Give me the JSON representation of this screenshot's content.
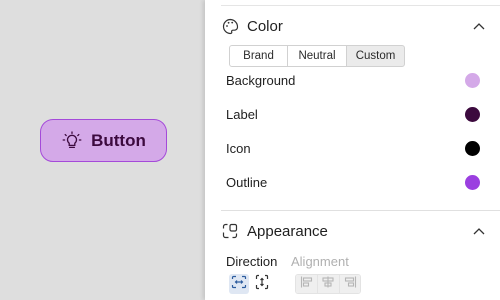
{
  "canvas": {
    "preview_button": {
      "label": "Button",
      "icon": "lightbulb-icon"
    }
  },
  "panel": {
    "color_section": {
      "title": "Color",
      "icon": "palette-icon",
      "tabs": [
        {
          "label": "Brand",
          "selected": false
        },
        {
          "label": "Neutral",
          "selected": false
        },
        {
          "label": "Custom",
          "selected": true
        }
      ],
      "rows": [
        {
          "label": "Background",
          "color": "#d4a9e8"
        },
        {
          "label": "Label",
          "color": "#3c0a3e"
        },
        {
          "label": "Icon",
          "color": "#000000"
        },
        {
          "label": "Outline",
          "color": "#9b3fe0"
        }
      ]
    },
    "appearance_section": {
      "title": "Appearance",
      "icon": "appearance-icon",
      "direction_label": "Direction",
      "alignment_label": "Alignment",
      "direction_options": [
        {
          "icon": "horizontal-direction-icon",
          "selected": true
        },
        {
          "icon": "vertical-direction-icon",
          "selected": false
        }
      ],
      "alignment_options": [
        {
          "icon": "align-start-icon",
          "enabled": false
        },
        {
          "icon": "align-center-icon",
          "enabled": false
        },
        {
          "icon": "align-end-icon",
          "enabled": false
        }
      ]
    }
  }
}
